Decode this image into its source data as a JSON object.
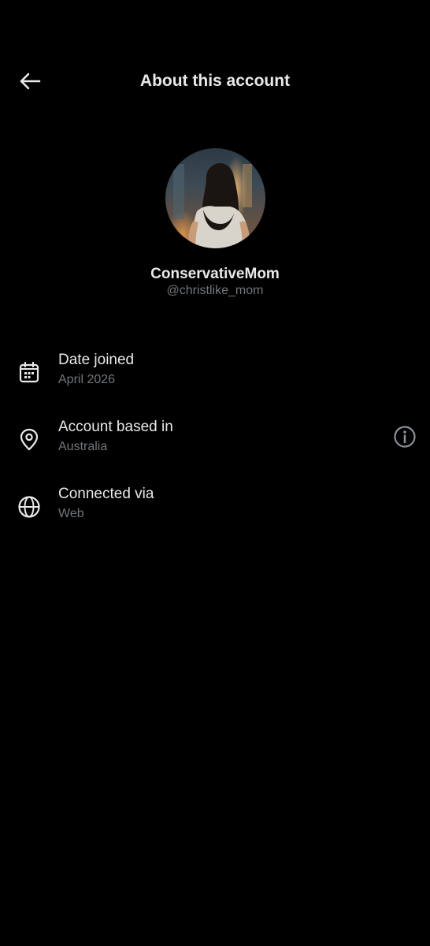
{
  "header": {
    "title": "About this account",
    "back_icon": "arrow-left-icon"
  },
  "profile": {
    "display_name": "ConservativeMom",
    "handle": "@christlike_mom"
  },
  "details": [
    {
      "icon": "calendar-icon",
      "title": "Date joined",
      "value": "April 2026"
    },
    {
      "icon": "location-pin-icon",
      "title": "Account based in",
      "value": "Australia",
      "action_icon": "info-icon"
    },
    {
      "icon": "globe-icon",
      "title": "Connected via",
      "value": "Web"
    }
  ],
  "colors": {
    "background": "#000000",
    "primary_text": "#e7e9ea",
    "secondary_text": "#71767b"
  }
}
